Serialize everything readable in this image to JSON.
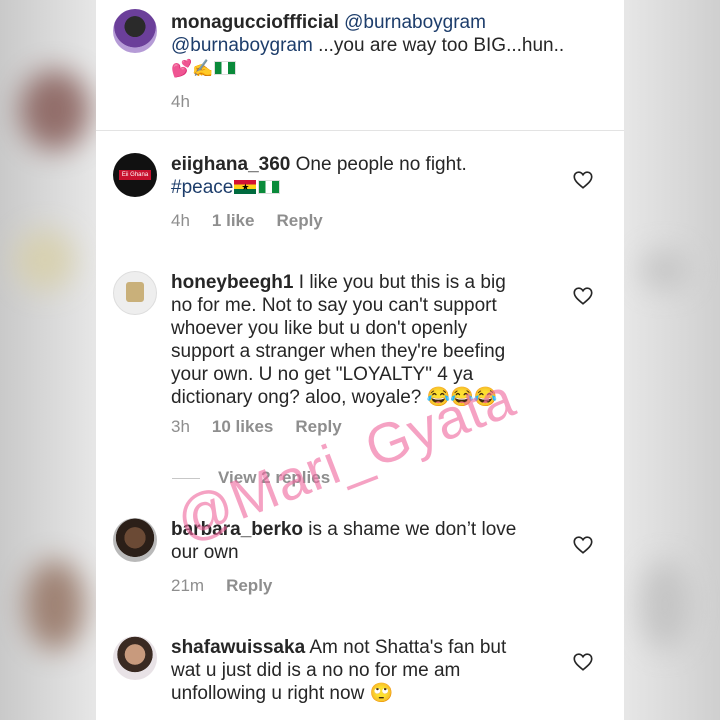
{
  "comments": [
    {
      "username": "monaguccioffficial",
      "mention": "@burnaboygram",
      "line2_mention": "@burnaboygram",
      "line2_text": " ...you are way too BIG...hun..",
      "emojis": "💕✍️",
      "time": "4h",
      "likes": "",
      "reply": ""
    },
    {
      "username": "eiighana_360",
      "text": " One people no fight.",
      "hashtag": "#peace",
      "time": "4h",
      "likes": "1 like",
      "reply": "Reply",
      "avatar_label": "Eii Ghana"
    },
    {
      "username": "honeybeegh1",
      "text_lines": [
        " I like you but this is a big",
        "no for me.  Not to say you can't support",
        "whoever you like but u don't openly",
        "support a stranger when they're beefing",
        "your own. U no get \"LOYALTY\" 4 ya",
        "dictionary ong?  aloo, woyale? 😂😂😂"
      ],
      "time": "3h",
      "likes": "10 likes",
      "reply": "Reply",
      "view_replies": "View 2 replies"
    },
    {
      "username": "barbara_berko",
      "text_lines": [
        " is a shame we don’t love",
        "our own"
      ],
      "time": "21m",
      "reply": "Reply"
    },
    {
      "username": "shafawuissaka",
      "text_lines": [
        " Am not Shatta's fan but",
        "wat u just did is a no no for me am",
        "unfollowing u right now 🙄"
      ]
    }
  ],
  "watermark": "@Mari_Gyata",
  "colors": {
    "background": "#ffffff",
    "text": "#262626",
    "meta": "#8e8e8e",
    "mention": "#1d3d6b",
    "watermark": "#f06aa0"
  },
  "icons": {
    "like": "heart-outline-icon"
  }
}
